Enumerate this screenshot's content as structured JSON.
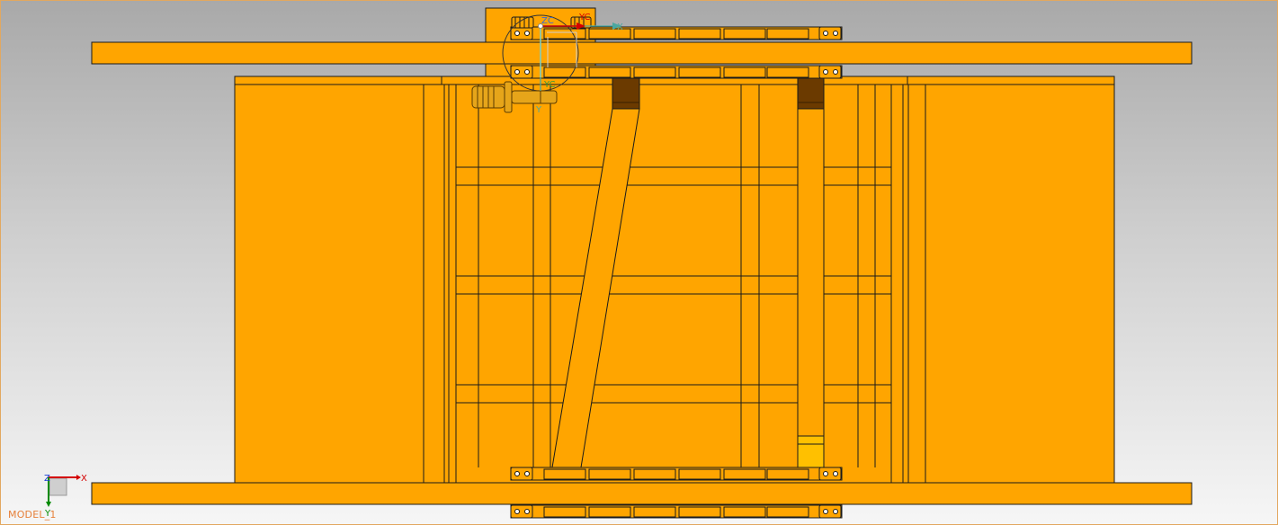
{
  "viewport": {
    "model_label": "MODEL_1",
    "background_top": "#a9a9a9",
    "background_bottom": "#f6f6f6",
    "border_color": "#e2a860"
  },
  "part": {
    "body_color": "#ffa500",
    "edge_color": "#1a1a1a",
    "dark_block_color": "#6b3a00",
    "highlight_color": "#ffc000",
    "motor_color": "#e6a51a"
  },
  "csys": {
    "label_zc": "ZC",
    "label_yc_top": "YC",
    "label_yc_mid": "YC",
    "label_x": "X",
    "label_y": "Y"
  },
  "triad": {
    "label_z": "Z",
    "label_x": "X",
    "label_y": "Y",
    "colors": {
      "x": "#d40000",
      "y": "#008a00",
      "z": "#1a3fd6"
    }
  }
}
